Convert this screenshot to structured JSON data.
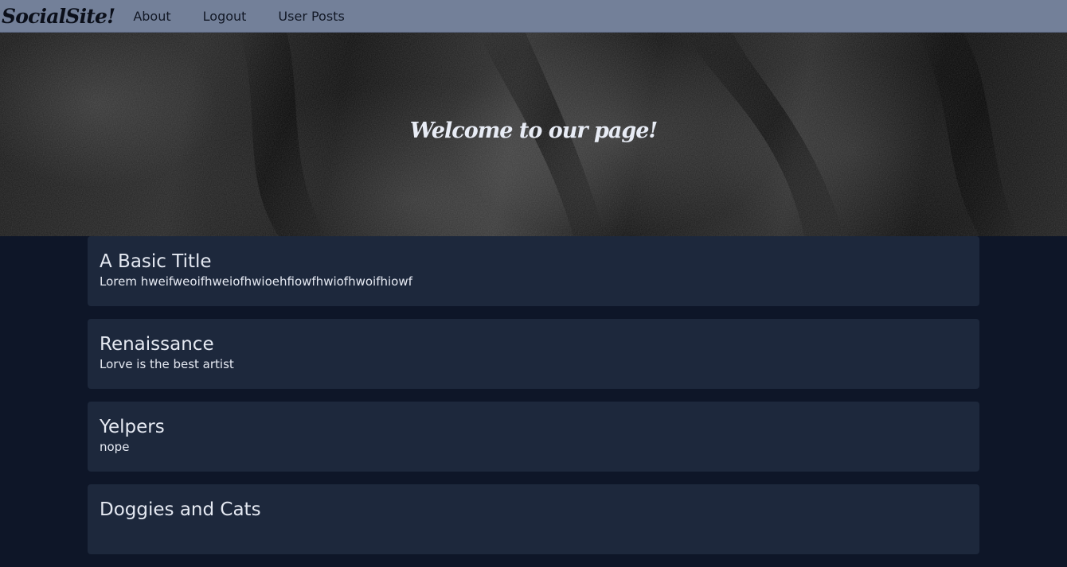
{
  "navbar": {
    "brand": "SocialSite!",
    "links": [
      "About",
      "Logout",
      "User Posts"
    ],
    "background": "#738099"
  },
  "hero": {
    "title": "Welcome to our page!"
  },
  "posts": [
    {
      "title": "A Basic Title",
      "body": "Lorem hweifweoifhweiofhwioehfiowfhwiofhwoifhiowf"
    },
    {
      "title": "Renaissance",
      "body": "Lorve is the best artist"
    },
    {
      "title": "Yelpers",
      "body": "nope"
    },
    {
      "title": "Doggies and Cats",
      "body": ""
    }
  ],
  "colors": {
    "page_background": "#0e1628",
    "card_background": "#1d283c",
    "text": "#e5e9f2"
  }
}
